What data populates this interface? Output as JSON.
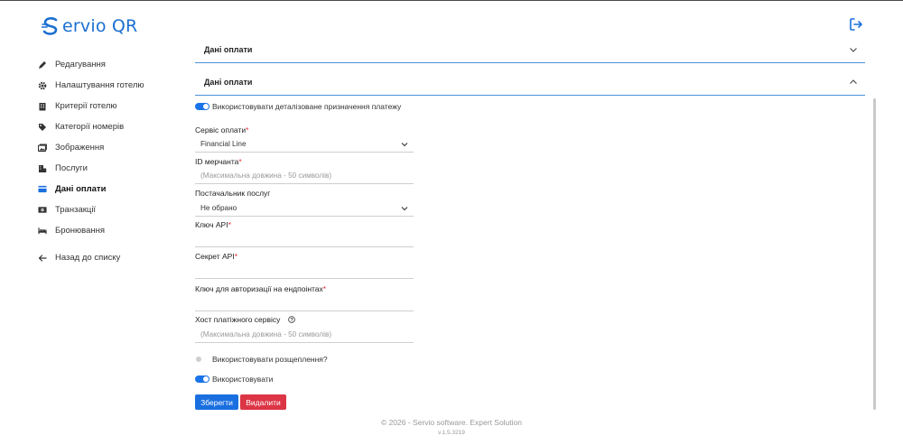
{
  "brand": {
    "logo_text": "ervio QR",
    "accent": "#1b6fd1"
  },
  "header": {
    "logout_icon": "logout-icon"
  },
  "sidebar": {
    "items": [
      {
        "label": "Редагування",
        "icon": "pencil-icon"
      },
      {
        "label": "Налаштування готелю",
        "icon": "gear-icon"
      },
      {
        "label": "Критерії готелю",
        "icon": "building-icon"
      },
      {
        "label": "Категорії номерів",
        "icon": "tag-icon"
      },
      {
        "label": "Зображення",
        "icon": "images-icon"
      },
      {
        "label": "Послуги",
        "icon": "services-icon"
      },
      {
        "label": "Дані оплати",
        "icon": "credit-card-icon",
        "active": true
      },
      {
        "label": "Транзакції",
        "icon": "cash-icon"
      },
      {
        "label": "Бронювання",
        "icon": "bed-icon"
      }
    ],
    "back_label": "Назад до списку"
  },
  "main": {
    "section_collapsed_title": "Дані оплати",
    "section_expanded_title": "Дані оплати",
    "detailed_purpose_toggle": {
      "label": "Використовувати деталізоване призначення платежу",
      "on": true
    },
    "fields": {
      "payment_service": {
        "label": "Сервіс оплати",
        "value": "Financial Line",
        "required": "*"
      },
      "merchant_id": {
        "label": "ID мерчанта",
        "placeholder": "(Максимальна довжина - 50 символів)",
        "required": "*"
      },
      "provider": {
        "label": "Постачальник послуг",
        "value": "Не обрано"
      },
      "api_key": {
        "label": "Ключ API",
        "value": "",
        "required": "*"
      },
      "api_secret": {
        "label": "Секрет API",
        "value": "",
        "required": "*"
      },
      "endpoint_key": {
        "label": "Ключ для авторизації на ендпоінтах",
        "value": "",
        "required": "*"
      },
      "host": {
        "label": "Хост платіжного сервісу",
        "placeholder": "(Максимальна довжина - 50 символів)"
      }
    },
    "split_toggle": {
      "label": "Використовувати розщеплення?",
      "on": false
    },
    "use_toggle": {
      "label": "Використовувати",
      "on": true
    },
    "buttons": {
      "save": "Зберегти",
      "delete": "Видалити"
    }
  },
  "footer": {
    "copyright": "© 2026 - Servio software. Expert Solution",
    "version": "v.1.5.3219"
  }
}
